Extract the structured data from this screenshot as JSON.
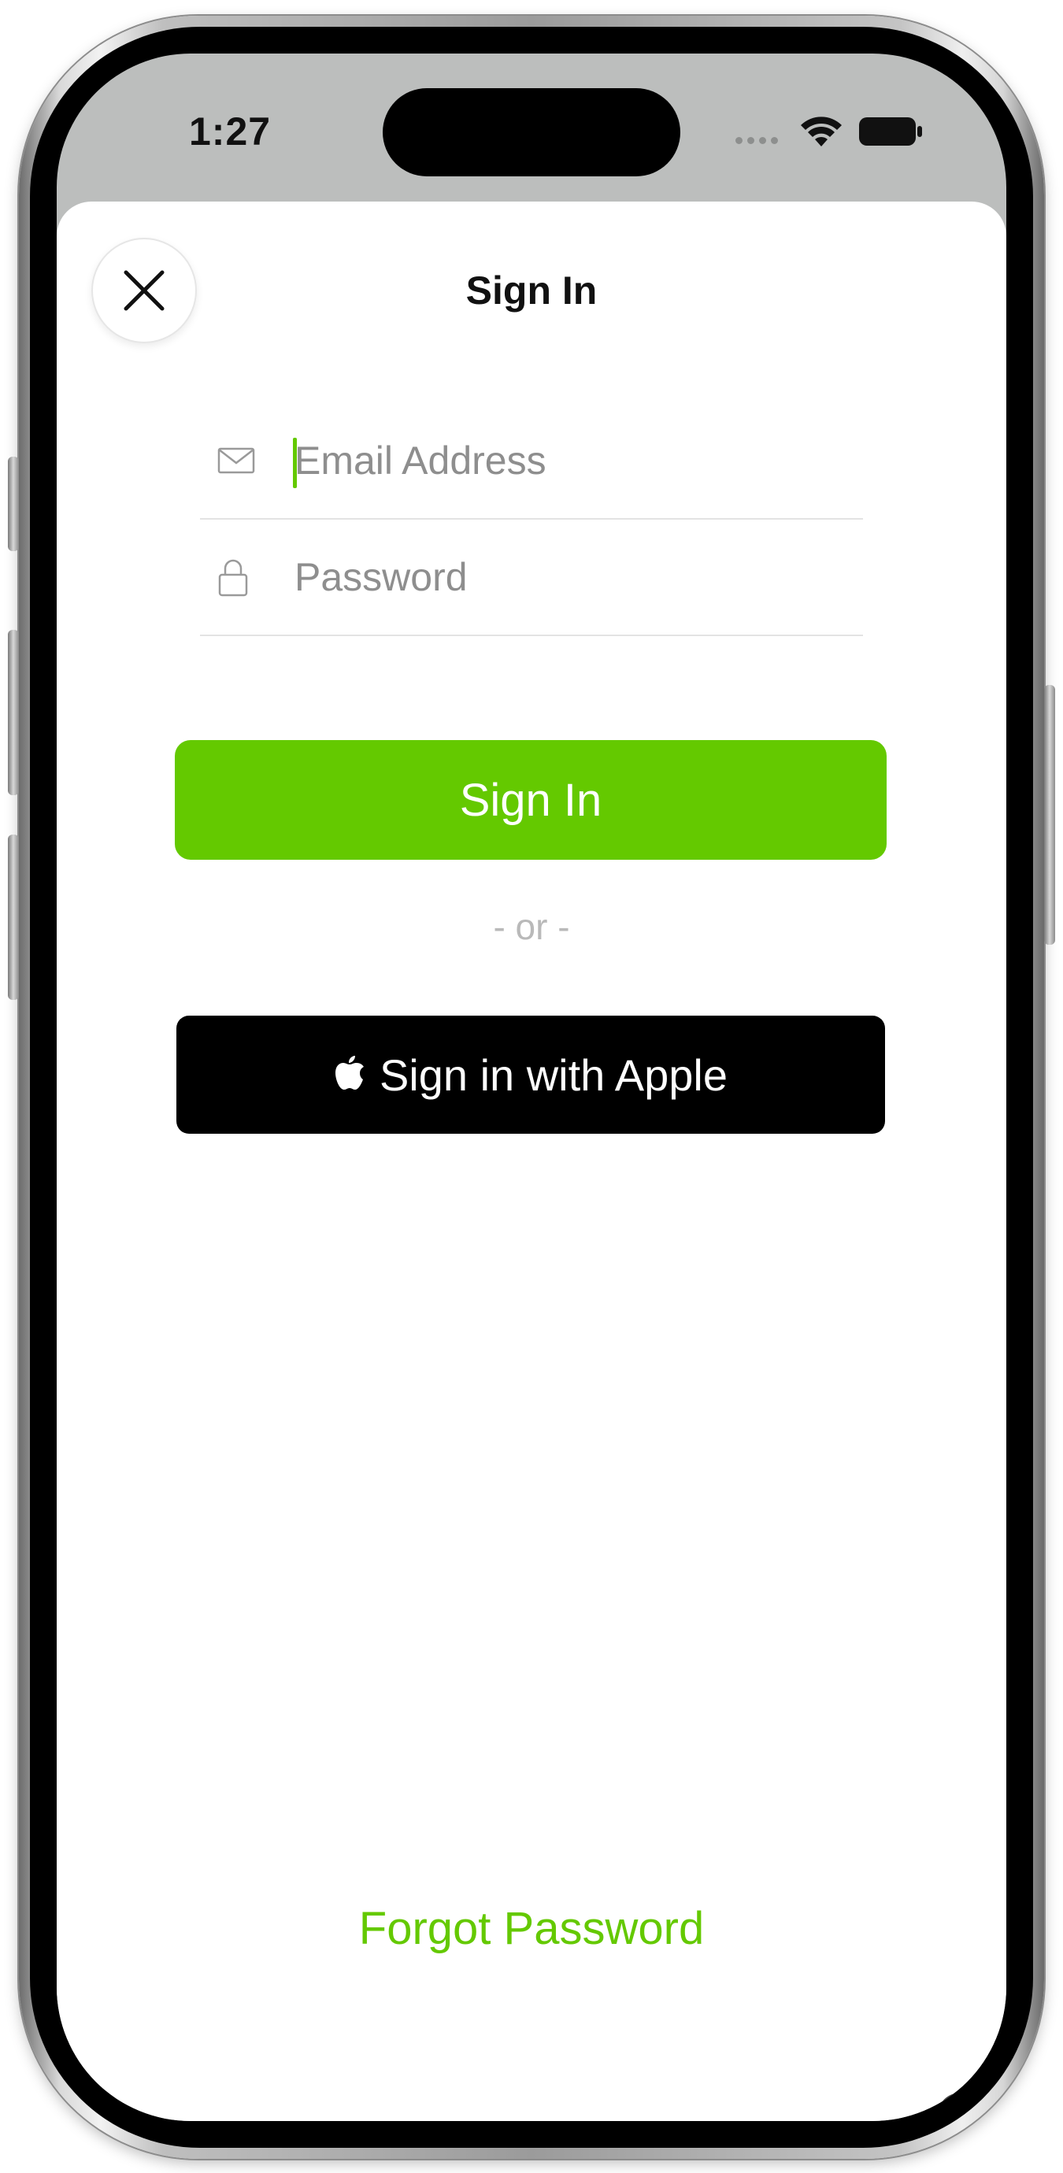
{
  "status_bar": {
    "time": "1:27"
  },
  "sheet": {
    "title": "Sign In",
    "close_icon": "close-icon"
  },
  "form": {
    "email": {
      "placeholder": "Email Address",
      "value": "",
      "icon": "envelope-icon"
    },
    "password": {
      "placeholder": "Password",
      "value": "",
      "icon": "lock-icon"
    },
    "signin_label": "Sign In",
    "or_text": "- or -",
    "apple_label": "Sign in with Apple",
    "apple_icon": "apple-logo-icon",
    "forgot_label": "Forgot Password"
  },
  "colors": {
    "accent": "#64c900",
    "apple_button": "#000000",
    "status_bar_bg": "#bcbebd"
  }
}
